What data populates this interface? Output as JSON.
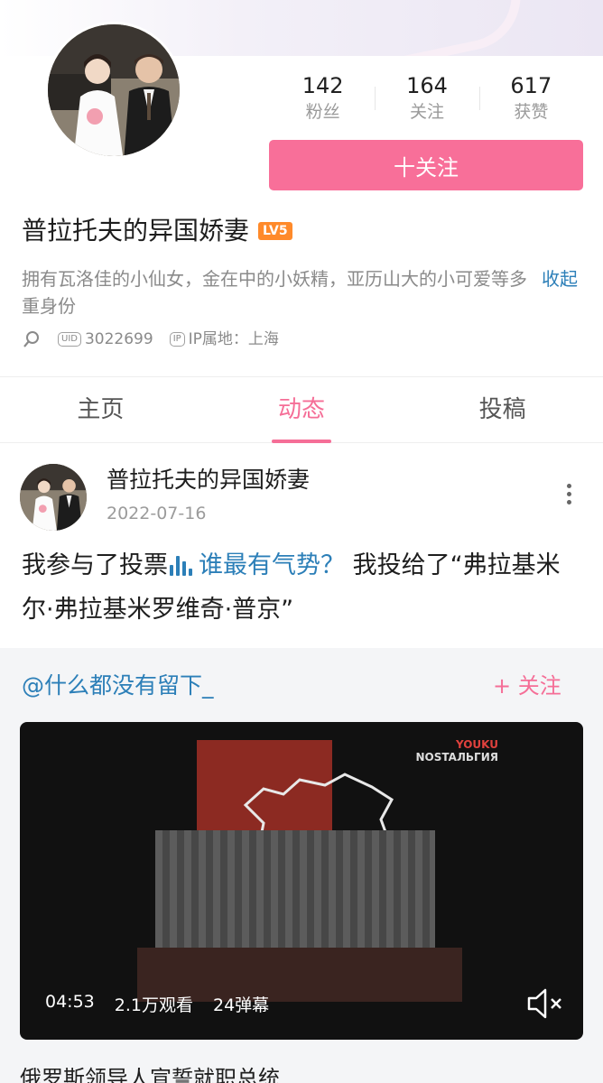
{
  "profile": {
    "stats": [
      {
        "value": "142",
        "label": "粉丝"
      },
      {
        "value": "164",
        "label": "关注"
      },
      {
        "value": "617",
        "label": "获赞"
      }
    ],
    "follow_label": "十关注",
    "name": "普拉托夫的异国娇妻",
    "level_badge": "LV5",
    "bio": "拥有瓦洛佳的小仙女，金在中的小妖精，亚历山大的小可爱等多重身份",
    "collapse_label": "收起",
    "uid_tag": "UID",
    "uid": "3022699",
    "ip_tag": "IP",
    "ip_location": "IP属地：上海"
  },
  "tabs": [
    {
      "label": "主页",
      "active": false
    },
    {
      "label": "动态",
      "active": true
    },
    {
      "label": "投稿",
      "active": false
    }
  ],
  "post": {
    "author": "普拉托夫的异国娇妻",
    "date": "2022-07-16",
    "text_prefix": "我参与了投票",
    "vote_title": "谁最有气势？",
    "text_suffix": " 我投给了“弗拉基米尔·弗拉基米罗维奇·普京”",
    "repost": {
      "user": "@什么都没有留下_",
      "follow_label": "+ 关注",
      "video": {
        "watermark_top": "YOUKU",
        "watermark_bottom": "NOSTAЛЬГИЯ",
        "duration": "04:53",
        "views": "2.1万观看",
        "danmaku": "24弹幕"
      },
      "caption": "俄罗斯领导人宣誓就职总统"
    }
  },
  "colors": {
    "accent_pink": "#f86f99",
    "link_blue": "#2c7fb8",
    "level_orange": "#ff8a2a"
  }
}
